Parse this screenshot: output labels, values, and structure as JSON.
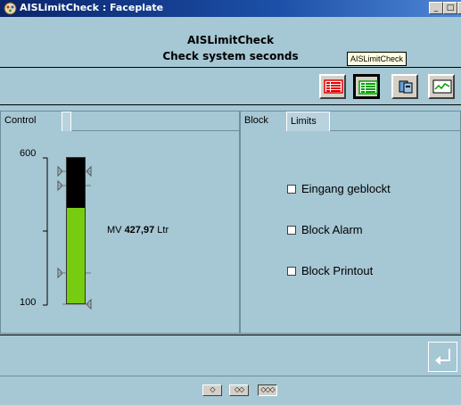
{
  "window": {
    "title": "AISLimitCheck : Faceplate",
    "buttons": [
      "_",
      "□",
      "×"
    ]
  },
  "header": {
    "title": "AISLimitCheck",
    "subtitle": "Check system seconds",
    "tooltip": "AISLimitCheck"
  },
  "toolbar": {
    "buttons": [
      "alarm-list-icon",
      "trend-list-icon",
      "batch-icon",
      "trend-curve-icon"
    ],
    "colors": {
      "red": "#e00000",
      "green": "#00a000",
      "accent": "#0000c0"
    }
  },
  "left_panel": {
    "tab": "Control",
    "scale": {
      "max_label": "600",
      "min_label": "100",
      "max": 600,
      "min": 100
    },
    "bar_value": 427.97,
    "bar_color": "#77cc11",
    "mv_label": "MV",
    "mv_value": "427,97",
    "mv_unit": "Ltr"
  },
  "right_panel": {
    "tabs": [
      "Block",
      "Limits"
    ],
    "checkboxes": [
      {
        "label": "Eingang geblockt",
        "checked": false
      },
      {
        "label": "Block Alarm",
        "checked": false
      },
      {
        "label": "Block Printout",
        "checked": false
      }
    ]
  },
  "footer": {
    "enter_icon": "enter-icon",
    "nav_buttons": [
      "◇",
      "◇◇",
      "◇◇◇"
    ]
  }
}
